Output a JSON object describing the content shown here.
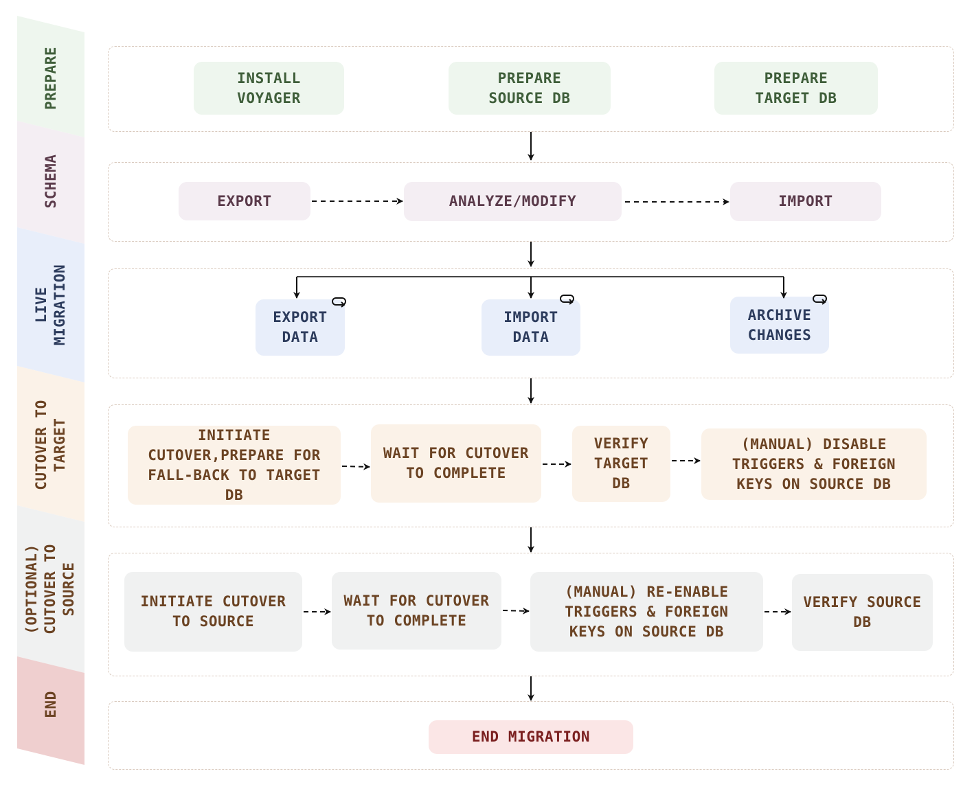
{
  "colors": {
    "prepare_band": "#eef6ee",
    "prepare_text": "#3f5e3a",
    "schema_band": "#f4eef3",
    "schema_text": "#5a3a4a",
    "live_band": "#e8eefa",
    "live_text": "#2c3b5c",
    "cutover_band": "#fbf2e8",
    "cutover_text": "#6b4323",
    "optional_band": "#f0f1f1",
    "optional_text": "#6b4323",
    "end_band": "#efcfcf",
    "end_text": "#6b4323",
    "lane_border": "#d9c9bd",
    "arrow": "#111111"
  },
  "phases": [
    {
      "id": "prepare",
      "label": "PREPARE"
    },
    {
      "id": "schema",
      "label": "SCHEMA"
    },
    {
      "id": "live",
      "label": "LIVE\nMIGRATION"
    },
    {
      "id": "cutover",
      "label": "CUTOVER TO\nTARGET"
    },
    {
      "id": "optional",
      "label": "(OPTIONAL)\nCUTOVER TO\nSOURCE"
    },
    {
      "id": "end",
      "label": "END"
    }
  ],
  "nodes": {
    "prepare": [
      "INSTALL\nVOYAGER",
      "PREPARE\nSOURCE DB",
      "PREPARE\nTARGET DB"
    ],
    "schema": [
      "EXPORT",
      "ANALYZE/MODIFY",
      "IMPORT"
    ],
    "live": [
      "EXPORT\nDATA",
      "IMPORT\nDATA",
      "ARCHIVE\nCHANGES"
    ],
    "cutover": [
      "INITIATE\nCUTOVER,PREPARE FOR\nFALL-BACK TO TARGET\nDB",
      "WAIT FOR CUTOVER\nTO COMPLETE",
      "VERIFY\nTARGET\nDB",
      "(MANUAL) DISABLE\nTRIGGERS & FOREIGN\nKEYS ON SOURCE DB"
    ],
    "optional": [
      "INITIATE CUTOVER\nTO SOURCE",
      "WAIT FOR CUTOVER\nTO COMPLETE",
      "(MANUAL) RE-ENABLE\nTRIGGERS & FOREIGN\nKEYS ON SOURCE DB",
      "VERIFY SOURCE\nDB"
    ],
    "end": [
      "END MIGRATION"
    ]
  },
  "icons": {
    "loop": "loop-arrow-icon",
    "arrow_solid": "arrow-down-icon",
    "arrow_dashed": "dashed-arrow-right-icon"
  }
}
